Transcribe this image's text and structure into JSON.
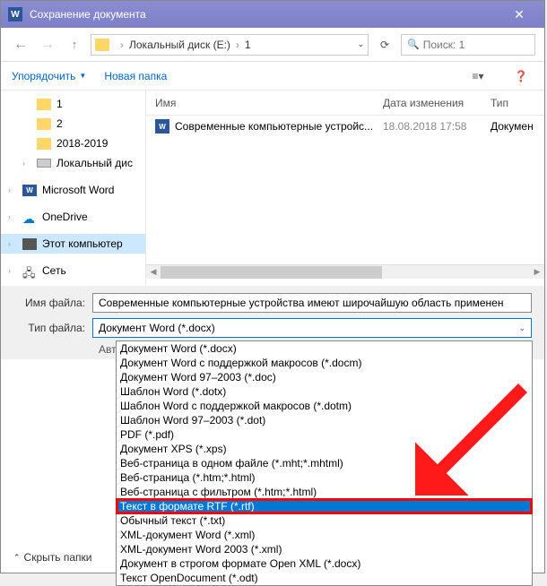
{
  "titlebar": {
    "title": "Сохранение документа"
  },
  "breadcrumb": {
    "drive": "Локальный диск (E:)",
    "folder": "1"
  },
  "search": {
    "placeholder": "Поиск: 1"
  },
  "toolbar": {
    "organize": "Упорядочить",
    "new_folder": "Новая папка"
  },
  "sidebar": {
    "items": [
      {
        "label": "1",
        "icon": "folder"
      },
      {
        "label": "2",
        "icon": "folder"
      },
      {
        "label": "2018-2019",
        "icon": "folder"
      },
      {
        "label": "Локальный дис",
        "icon": "drive"
      },
      {
        "label": "Microsoft Word",
        "icon": "word"
      },
      {
        "label": "OneDrive",
        "icon": "cloud"
      },
      {
        "label": "Этот компьютер",
        "icon": "pc"
      },
      {
        "label": "Сеть",
        "icon": "network"
      }
    ]
  },
  "columns": {
    "name": "Имя",
    "date": "Дата изменения",
    "type": "Тип"
  },
  "files": [
    {
      "name": "Современные компьютерные устройс...",
      "date": "18.08.2018 17:58",
      "type": "Докумен"
    }
  ],
  "fields": {
    "filename_label": "Имя файла:",
    "filename_value": "Современные компьютерные устройства имеют широчайшую область применен",
    "filetype_label": "Тип файла:",
    "filetype_value": "Документ Word (*.docx)",
    "authors_label": "Авторы:"
  },
  "dropdown": {
    "items": [
      "Документ Word (*.docx)",
      "Документ Word с поддержкой макросов (*.docm)",
      "Документ Word 97–2003 (*.doc)",
      "Шаблон Word (*.dotx)",
      "Шаблон Word с поддержкой макросов (*.dotm)",
      "Шаблон Word 97–2003 (*.dot)",
      "PDF (*.pdf)",
      "Документ XPS (*.xps)",
      "Веб-страница в одном файле (*.mht;*.mhtml)",
      "Веб-страница (*.htm;*.html)",
      "Веб-страница с фильтром (*.htm;*.html)",
      "Текст в формате RTF (*.rtf)",
      "Обычный текст (*.txt)",
      "XML-документ Word (*.xml)",
      "XML-документ Word 2003 (*.xml)",
      "Документ в строгом формате Open XML (*.docx)",
      "Текст OpenDocument (*.odt)"
    ],
    "selected_index": 11
  },
  "footer": {
    "hide_folders": "Скрыть папки"
  }
}
